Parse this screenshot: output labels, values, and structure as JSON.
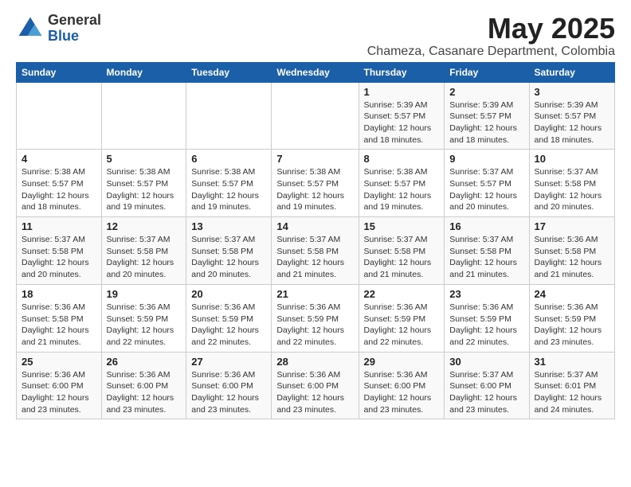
{
  "logo": {
    "general": "General",
    "blue": "Blue"
  },
  "title": "May 2025",
  "location": "Chameza, Casanare Department, Colombia",
  "weekdays": [
    "Sunday",
    "Monday",
    "Tuesday",
    "Wednesday",
    "Thursday",
    "Friday",
    "Saturday"
  ],
  "weeks": [
    [
      {
        "day": "",
        "info": ""
      },
      {
        "day": "",
        "info": ""
      },
      {
        "day": "",
        "info": ""
      },
      {
        "day": "",
        "info": ""
      },
      {
        "day": "1",
        "info": "Sunrise: 5:39 AM\nSunset: 5:57 PM\nDaylight: 12 hours and 18 minutes."
      },
      {
        "day": "2",
        "info": "Sunrise: 5:39 AM\nSunset: 5:57 PM\nDaylight: 12 hours and 18 minutes."
      },
      {
        "day": "3",
        "info": "Sunrise: 5:39 AM\nSunset: 5:57 PM\nDaylight: 12 hours and 18 minutes."
      }
    ],
    [
      {
        "day": "4",
        "info": "Sunrise: 5:38 AM\nSunset: 5:57 PM\nDaylight: 12 hours and 18 minutes."
      },
      {
        "day": "5",
        "info": "Sunrise: 5:38 AM\nSunset: 5:57 PM\nDaylight: 12 hours and 19 minutes."
      },
      {
        "day": "6",
        "info": "Sunrise: 5:38 AM\nSunset: 5:57 PM\nDaylight: 12 hours and 19 minutes."
      },
      {
        "day": "7",
        "info": "Sunrise: 5:38 AM\nSunset: 5:57 PM\nDaylight: 12 hours and 19 minutes."
      },
      {
        "day": "8",
        "info": "Sunrise: 5:38 AM\nSunset: 5:57 PM\nDaylight: 12 hours and 19 minutes."
      },
      {
        "day": "9",
        "info": "Sunrise: 5:37 AM\nSunset: 5:57 PM\nDaylight: 12 hours and 20 minutes."
      },
      {
        "day": "10",
        "info": "Sunrise: 5:37 AM\nSunset: 5:58 PM\nDaylight: 12 hours and 20 minutes."
      }
    ],
    [
      {
        "day": "11",
        "info": "Sunrise: 5:37 AM\nSunset: 5:58 PM\nDaylight: 12 hours and 20 minutes."
      },
      {
        "day": "12",
        "info": "Sunrise: 5:37 AM\nSunset: 5:58 PM\nDaylight: 12 hours and 20 minutes."
      },
      {
        "day": "13",
        "info": "Sunrise: 5:37 AM\nSunset: 5:58 PM\nDaylight: 12 hours and 20 minutes."
      },
      {
        "day": "14",
        "info": "Sunrise: 5:37 AM\nSunset: 5:58 PM\nDaylight: 12 hours and 21 minutes."
      },
      {
        "day": "15",
        "info": "Sunrise: 5:37 AM\nSunset: 5:58 PM\nDaylight: 12 hours and 21 minutes."
      },
      {
        "day": "16",
        "info": "Sunrise: 5:37 AM\nSunset: 5:58 PM\nDaylight: 12 hours and 21 minutes."
      },
      {
        "day": "17",
        "info": "Sunrise: 5:36 AM\nSunset: 5:58 PM\nDaylight: 12 hours and 21 minutes."
      }
    ],
    [
      {
        "day": "18",
        "info": "Sunrise: 5:36 AM\nSunset: 5:58 PM\nDaylight: 12 hours and 21 minutes."
      },
      {
        "day": "19",
        "info": "Sunrise: 5:36 AM\nSunset: 5:59 PM\nDaylight: 12 hours and 22 minutes."
      },
      {
        "day": "20",
        "info": "Sunrise: 5:36 AM\nSunset: 5:59 PM\nDaylight: 12 hours and 22 minutes."
      },
      {
        "day": "21",
        "info": "Sunrise: 5:36 AM\nSunset: 5:59 PM\nDaylight: 12 hours and 22 minutes."
      },
      {
        "day": "22",
        "info": "Sunrise: 5:36 AM\nSunset: 5:59 PM\nDaylight: 12 hours and 22 minutes."
      },
      {
        "day": "23",
        "info": "Sunrise: 5:36 AM\nSunset: 5:59 PM\nDaylight: 12 hours and 22 minutes."
      },
      {
        "day": "24",
        "info": "Sunrise: 5:36 AM\nSunset: 5:59 PM\nDaylight: 12 hours and 23 minutes."
      }
    ],
    [
      {
        "day": "25",
        "info": "Sunrise: 5:36 AM\nSunset: 6:00 PM\nDaylight: 12 hours and 23 minutes."
      },
      {
        "day": "26",
        "info": "Sunrise: 5:36 AM\nSunset: 6:00 PM\nDaylight: 12 hours and 23 minutes."
      },
      {
        "day": "27",
        "info": "Sunrise: 5:36 AM\nSunset: 6:00 PM\nDaylight: 12 hours and 23 minutes."
      },
      {
        "day": "28",
        "info": "Sunrise: 5:36 AM\nSunset: 6:00 PM\nDaylight: 12 hours and 23 minutes."
      },
      {
        "day": "29",
        "info": "Sunrise: 5:36 AM\nSunset: 6:00 PM\nDaylight: 12 hours and 23 minutes."
      },
      {
        "day": "30",
        "info": "Sunrise: 5:37 AM\nSunset: 6:00 PM\nDaylight: 12 hours and 23 minutes."
      },
      {
        "day": "31",
        "info": "Sunrise: 5:37 AM\nSunset: 6:01 PM\nDaylight: 12 hours and 24 minutes."
      }
    ]
  ]
}
